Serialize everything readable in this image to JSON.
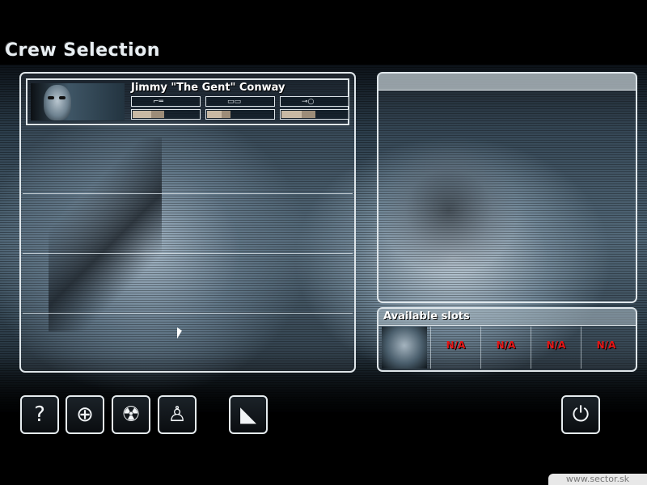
{
  "screen": {
    "title": "Crew Selection"
  },
  "crew": [
    {
      "name": "Jimmy \"The Gent\" Conway",
      "stats": [
        {
          "icon": "gun-icon",
          "glyph": "⌐═",
          "skill": 0.46
        },
        {
          "icon": "car-icon",
          "glyph": "▭▭",
          "skill": 0.35
        },
        {
          "icon": "key-icon",
          "glyph": "⊸○",
          "skill": 0.5
        }
      ]
    }
  ],
  "slots": {
    "title": "Available slots",
    "items": [
      {
        "type": "portrait"
      },
      {
        "type": "na",
        "label": "N/A"
      },
      {
        "type": "na",
        "label": "N/A"
      },
      {
        "type": "na",
        "label": "N/A"
      },
      {
        "type": "na",
        "label": "N/A"
      }
    ]
  },
  "toolbar": [
    {
      "name": "equipment-button",
      "icon": "briefcase-help-icon",
      "glyph": "?"
    },
    {
      "name": "target-button",
      "icon": "crosshair-icon",
      "glyph": "⊕"
    },
    {
      "name": "radiation-button",
      "icon": "radiation-icon",
      "glyph": "☢"
    },
    {
      "name": "crew-member-button",
      "icon": "person-icon",
      "glyph": "♙"
    },
    {
      "name": "plan-button",
      "icon": "map-sweep-icon",
      "glyph": "◣"
    }
  ],
  "exit_button": {
    "icon": "plug-icon",
    "glyph": "⏻"
  },
  "watermark": "www.sector.sk",
  "colors": {
    "na": "#e41515",
    "border": "#dfe6ea",
    "skill": "#c8b9a4"
  }
}
